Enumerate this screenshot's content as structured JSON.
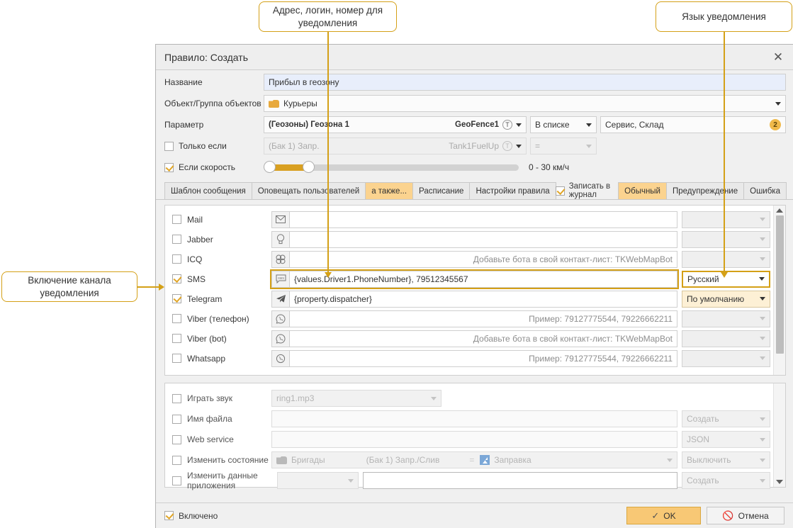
{
  "annotations": [
    {
      "id": "addr",
      "text": "Адрес, логин, номер для уведомления"
    },
    {
      "id": "lang",
      "text": "Язык уведомления"
    },
    {
      "id": "channel",
      "text": "Включение канала уведомления"
    }
  ],
  "dialog": {
    "title": "Правило: Создать",
    "close_icon": "close-icon"
  },
  "form": {
    "name_label": "Название",
    "name_value": "Прибыл в геозону",
    "object_label": "Объект/Группа объектов",
    "object_value": "Курьеры",
    "param_label": "Параметр",
    "param_value": "(Геозоны) Геозона 1",
    "param_code": "GeoFence1",
    "param_code_badge": "T",
    "param_condition": "В списке",
    "param_list_value": "Сервис, Склад",
    "param_list_count": "2",
    "only_if_label": "Только если",
    "only_if_value": "(Бак 1) Запр.",
    "only_if_code": "Tank1FuelUp",
    "only_if_code_badge": "T",
    "only_if_operator": "=",
    "speed_label": "Если скорость",
    "speed_value": "0 - 30 км/ч"
  },
  "tabs": [
    {
      "label": "Шаблон сообщения",
      "active": false
    },
    {
      "label": "Оповещать пользователей",
      "active": false
    },
    {
      "label": "а также...",
      "active": true
    },
    {
      "label": "Расписание",
      "active": false
    },
    {
      "label": "Настройки правила",
      "active": false
    }
  ],
  "tab_right": {
    "journal_label": "Записать в журнал",
    "levels": [
      {
        "label": "Обычный",
        "active": true
      },
      {
        "label": "Предупреждение",
        "active": false
      },
      {
        "label": "Ошибка",
        "active": false
      }
    ]
  },
  "channels": [
    {
      "label": "Mail",
      "icon": "envelope-icon",
      "checked": false,
      "value": "",
      "placeholder": "",
      "lang": "",
      "lang_state": "disabled"
    },
    {
      "label": "Jabber",
      "icon": "bulb-icon",
      "checked": false,
      "value": "",
      "placeholder": "",
      "lang": "",
      "lang_state": "disabled"
    },
    {
      "label": "ICQ",
      "icon": "icq-flower-icon",
      "checked": false,
      "value": "",
      "placeholder": "Добавьте бота в свой контакт-лист: TKWebMapBot",
      "lang": "",
      "lang_state": "disabled"
    },
    {
      "label": "SMS",
      "icon": "sms-bubble-icon",
      "checked": true,
      "value": "{values.Driver1.PhoneNumber}, 79512345567",
      "placeholder": "",
      "lang": "Русский",
      "lang_state": "highlight"
    },
    {
      "label": "Telegram",
      "icon": "telegram-plane-icon",
      "checked": true,
      "value": "{property.dispatcher}",
      "placeholder": "",
      "lang": "По умолчанию",
      "lang_state": "cream"
    },
    {
      "label": "Viber (телефон)",
      "icon": "viber-phone-icon",
      "checked": false,
      "value": "",
      "placeholder": "Пример: 79127775544, 79226662211",
      "lang": "",
      "lang_state": "disabled"
    },
    {
      "label": "Viber (bot)",
      "icon": "viber-bot-icon",
      "checked": false,
      "value": "",
      "placeholder": "Добавьте бота в свой контакт-лист: TKWebMapBot",
      "lang": "",
      "lang_state": "disabled"
    },
    {
      "label": "Whatsapp",
      "icon": "whatsapp-icon",
      "checked": false,
      "value": "",
      "placeholder": "Пример: 79127775544, 79226662211",
      "lang": "",
      "lang_state": "disabled"
    }
  ],
  "actions": {
    "sound_label": "Играть звук",
    "sound_value": "ring1.mp3",
    "filename_label": "Имя файла",
    "filename_value": "",
    "filename_right": "Создать",
    "webservice_label": "Web service",
    "webservice_value": "",
    "webservice_right": "JSON",
    "state_label": "Изменить состояние",
    "state_group": "Бригады",
    "state_param": "(Бак 1) Запр./Слив",
    "state_op": "=",
    "state_value": "Заправка",
    "state_right": "Выключить",
    "appdata_label": "Изменить данные приложения",
    "appdata_select": "",
    "appdata_value": "",
    "appdata_right": "Создать"
  },
  "footer": {
    "enabled_label": "Включено",
    "ok_label": "OK",
    "cancel_label": "Отмена"
  },
  "colors": {
    "accent": "#d4a017",
    "active_tab": "#fbd38f",
    "primary_button": "#f8c875",
    "name_field": "#e8eefb"
  }
}
